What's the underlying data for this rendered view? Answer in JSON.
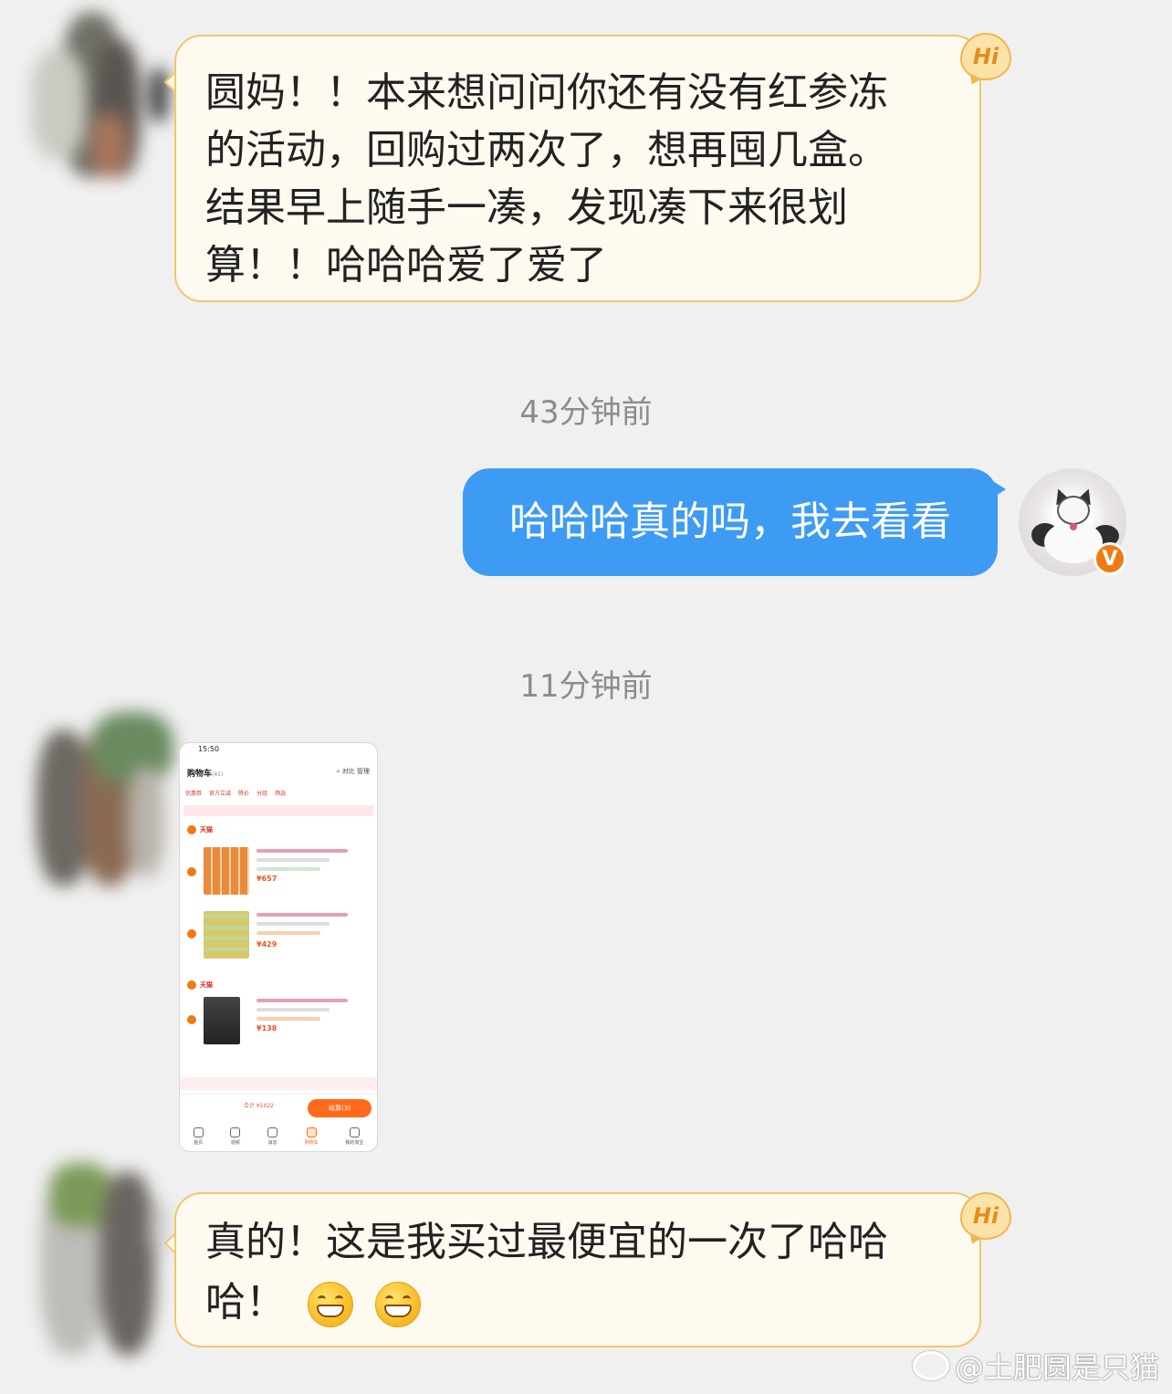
{
  "messages": {
    "msg1": {
      "lines": [
        "圆妈！！本来想问问你还有没有红参冻",
        "的活动，回购过两次了，想再囤几盒。",
        "结果早上随手一凑，发现凑下来很划",
        "算！！哈哈哈爱了爱了"
      ],
      "badge": "Hi"
    },
    "time1": "43分钟前",
    "msg2": {
      "text": "哈哈哈真的吗，我去看看",
      "verified_badge": "V"
    },
    "time2": "11分钟前",
    "msg3": {
      "lines": [
        "真的！这是我买过最便宜的一次了哈哈",
        "哈！"
      ],
      "badge": "Hi",
      "emojis": [
        "grin-emoji",
        "grin-emoji"
      ]
    }
  },
  "thumbnail": {
    "status_time": "15:50",
    "title": "购物车",
    "title_count": "(41)",
    "tools": [
      "对比",
      "管理"
    ],
    "filters": [
      "优惠券",
      "官方立减",
      "降价",
      "分组",
      "筛选"
    ],
    "shop1": "天猫",
    "shop2": "天猫",
    "price1": "¥657",
    "price2": "¥429",
    "price3": "¥138",
    "total": "合计 ¥1022",
    "checkout": "结算(3)",
    "tabs": [
      "首页",
      "视频",
      "消息",
      "购物车",
      "我的淘宝"
    ]
  },
  "watermark": "@土肥圆是只猫",
  "colors": {
    "background": "#f0f0f0",
    "incoming_bubble": "#fffaf0",
    "incoming_border": "#f3c56d",
    "outgoing_bubble": "#3d9bf3",
    "timestamp": "#8c8c8c",
    "verified": "#f07a12"
  }
}
